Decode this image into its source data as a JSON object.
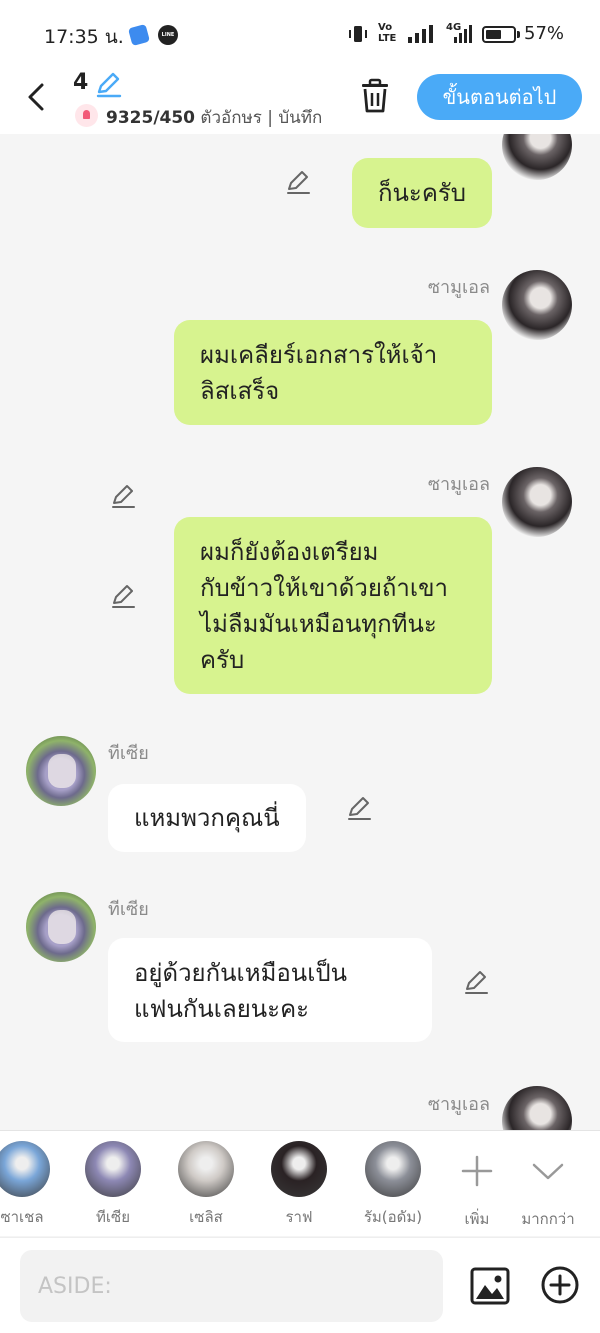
{
  "status_bar": {
    "time": "17:35 น.",
    "line_label": "LINE",
    "volte": "Vo\nLTE",
    "network": "4G",
    "battery_level": 0.57,
    "battery_text": "57%"
  },
  "header": {
    "episode_number": "4",
    "char_count": "9325/450",
    "char_suffix": " ตัวอักษร | บันทึก",
    "next_label": "ขั้นตอนต่อไป"
  },
  "messages": [
    {
      "side": "right",
      "sender": "",
      "lines": [
        "ก็นะครับ"
      ]
    },
    {
      "side": "right",
      "sender": "ซามูเอล",
      "lines": [
        "ผมเคลียร์เอกสารให้เจ้า",
        "ลิสเสร็จ"
      ]
    },
    {
      "side": "right",
      "sender": "ซามูเอล",
      "lines": [
        "ผมก็ยังต้องเตรียม",
        "กับข้าวให้เขาด้วยถ้าเขา",
        "ไม่ลืมมันเหมือนทุกทีนะ",
        "ครับ"
      ]
    },
    {
      "side": "left",
      "sender": "ทีเซีย",
      "lines": [
        "แหมพวกคุณนี่"
      ]
    },
    {
      "side": "left",
      "sender": "ทีเซีย",
      "lines": [
        "อยู่ด้วยกันเหมือนเป็น",
        "แฟนกันเลยนะคะ"
      ]
    },
    {
      "side": "right",
      "sender": "ซามูเอล",
      "lines": []
    }
  ],
  "characters": [
    {
      "name": "ซาเชล",
      "color": "#7aa6d8"
    },
    {
      "name": "ทีเซีย",
      "color": "#8d88b4"
    },
    {
      "name": "เซลิส",
      "color": "#cfcac6"
    },
    {
      "name": "ราฟ",
      "color": "#2a2224"
    },
    {
      "name": "รัม(อดัม)",
      "color": "#8c8f98"
    }
  ],
  "char_actions": {
    "add_label": "เพิ่ม",
    "more_label": "มากกว่า"
  },
  "input": {
    "placeholder": "ASIDE:"
  },
  "colors": {
    "accent": "#4aaaf7",
    "bubble_right": "#d7f38f",
    "bubble_left": "#ffffff"
  }
}
